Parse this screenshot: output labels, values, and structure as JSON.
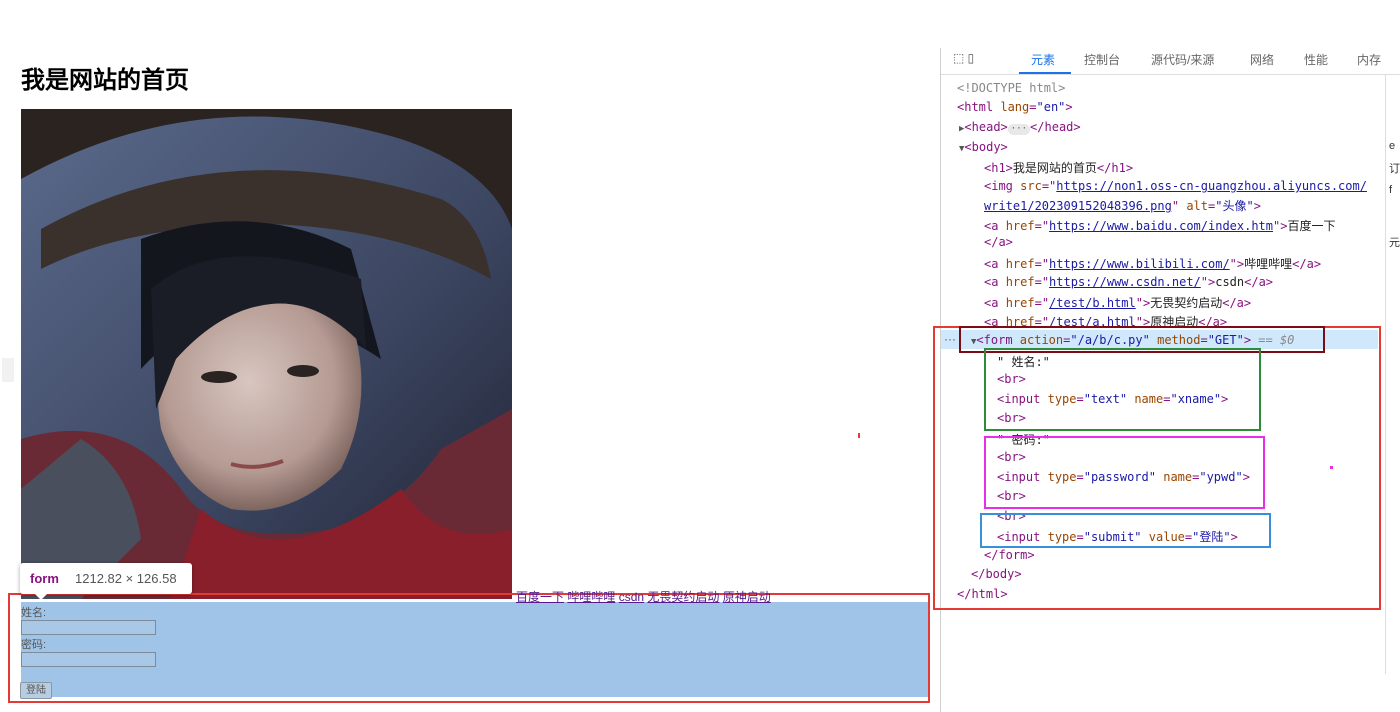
{
  "page": {
    "title": "我是网站的首页",
    "links": [
      "百度一下",
      "哔哩哔哩",
      "csdn",
      "无畏契约启动",
      "原神启动"
    ],
    "form": {
      "name_label": "姓名:",
      "pwd_label": "密码:",
      "submit_label": "登陆"
    }
  },
  "tooltip": {
    "tag": "form",
    "size": "1212.82 × 126.58"
  },
  "devtools": {
    "tabs": [
      "元素",
      "控制台",
      "源代码/来源",
      "网络",
      "性能",
      "内存"
    ],
    "tool_icons": "⬚ ▯",
    "side_pane_glyphs": [
      "e",
      "订",
      "f",
      "元"
    ],
    "dom": {
      "doctype": "<!DOCTYPE html>",
      "html_open_tag": "<html",
      "html_lang_attr": "lang",
      "html_lang_val": "\"en\"",
      "head_open": "<head>",
      "head_close": "</head>",
      "body_open": "<body>",
      "h1_open": "<h1>",
      "h1_text": "我是网站的首页",
      "h1_close": "</h1>",
      "img_tag": "<img",
      "img_src_attr": "src",
      "img_src_1": "https://non1.oss-cn-guangzhou.aliyuncs.com/",
      "img_src_2": "write1/202309152048396.png",
      "img_alt_attr": "alt",
      "img_alt_val": "\"头像\"",
      "a_tag": "<a",
      "href_attr": "href",
      "a1_href": "https://www.baidu.com/index.htm",
      "a1_text": "百度一下",
      "a_close": "</a>",
      "a2_href": "https://www.bilibili.com/",
      "a2_text": "哔哩哔哩",
      "a3_href": "https://www.csdn.net/",
      "a3_text": "csdn",
      "a4_href": "/test/b.html",
      "a4_text": "无畏契约启动",
      "a5_href": "/test/a.html",
      "a5_text": "原神启动",
      "form_tag": "<form",
      "form_action_attr": "action",
      "form_action_val": "\"/a/b/c.py\"",
      "form_method_attr": "method",
      "form_method_val": "\"GET\"",
      "selected_marker": "== $0",
      "text_name": "\" 姓名:\"",
      "br": "<br>",
      "input_tag": "<input",
      "type_attr": "type",
      "name_attr": "name",
      "value_attr": "value",
      "input1_type": "\"text\"",
      "input1_name": "\"xname\"",
      "text_pwd": "\" 密码:\"",
      "input2_type": "\"password\"",
      "input2_name": "\"ypwd\"",
      "input3_type": "\"submit\"",
      "input3_value": "\"登陆\"",
      "form_close": "</form>",
      "body_close": "</body>",
      "html_close": "</html>",
      "dots": "···"
    }
  },
  "colors": {
    "highlight_form": "#9fc4e7",
    "annotation_red": "#e53935",
    "annotation_maroon": "#7b0c16",
    "annotation_green": "#2e8b3a",
    "annotation_magenta": "#e630e6",
    "annotation_blue": "#3a8fd9",
    "devtools_tag": "#881280",
    "devtools_attr": "#994500",
    "devtools_value": "#1a1aa6"
  }
}
